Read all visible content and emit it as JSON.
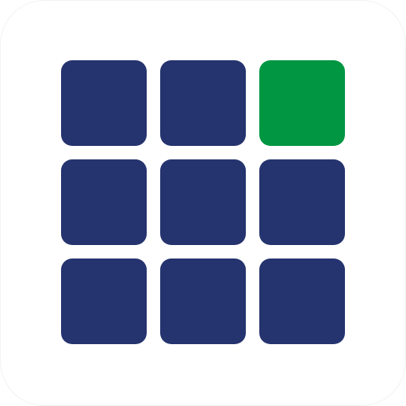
{
  "icon": {
    "background_color": "#ffffff",
    "tile_color": "#25346f",
    "accent_color": "#009642",
    "grid": {
      "rows": 3,
      "columns": 3,
      "accent_tile": {
        "row": 1,
        "column": 3
      }
    }
  }
}
